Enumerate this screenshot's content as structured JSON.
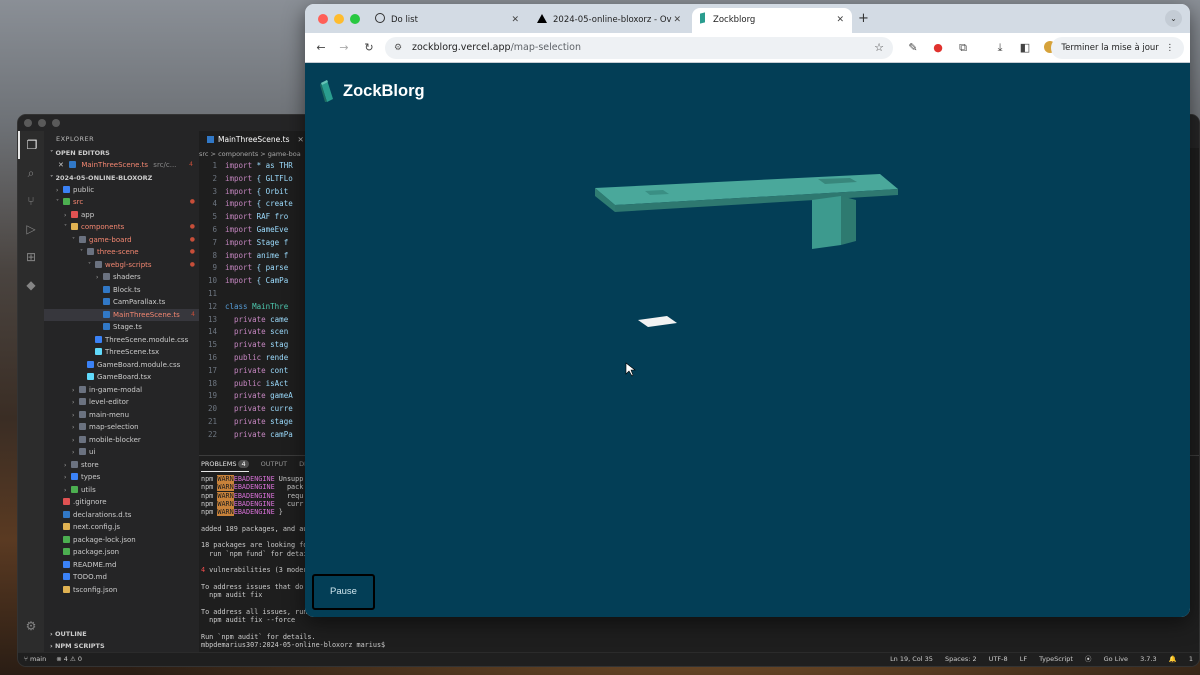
{
  "vscode": {
    "explorer_title": "EXPLORER",
    "open_editors_label": "OPEN EDITORS",
    "open_editor_file": "MainThreeScene.ts",
    "open_editor_path": "src/c...",
    "open_editor_count": "4",
    "project_label": "2024-05-ONLINE-BLOXORZ",
    "tree": [
      {
        "label": "public",
        "depth": 1,
        "folder": true,
        "open": false,
        "color": "#3b82f6"
      },
      {
        "label": "src",
        "depth": 1,
        "folder": true,
        "open": true,
        "color": "#4caf50",
        "red": true,
        "dot": true
      },
      {
        "label": "app",
        "depth": 2,
        "folder": true,
        "open": false,
        "color": "#e05252"
      },
      {
        "label": "components",
        "depth": 2,
        "folder": true,
        "open": true,
        "color": "#e0b252",
        "red": true,
        "dot": true
      },
      {
        "label": "game-board",
        "depth": 3,
        "folder": true,
        "open": true,
        "color": "#6b7280",
        "red": true,
        "dot": true
      },
      {
        "label": "three-scene",
        "depth": 4,
        "folder": true,
        "open": true,
        "color": "#6b7280",
        "red": true,
        "dot": true
      },
      {
        "label": "webgl-scripts",
        "depth": 5,
        "folder": true,
        "open": true,
        "color": "#6b7280",
        "red": true,
        "dot": true
      },
      {
        "label": "shaders",
        "depth": 6,
        "folder": true,
        "open": false,
        "color": "#6b7280"
      },
      {
        "label": "Block.ts",
        "depth": 6,
        "folder": false,
        "color": "#3178c6"
      },
      {
        "label": "CamParallax.ts",
        "depth": 6,
        "folder": false,
        "color": "#3178c6"
      },
      {
        "label": "MainThreeScene.ts",
        "depth": 6,
        "folder": false,
        "color": "#3178c6",
        "red": true,
        "selected": true,
        "count": "4"
      },
      {
        "label": "Stage.ts",
        "depth": 6,
        "folder": false,
        "color": "#3178c6"
      },
      {
        "label": "ThreeScene.module.css",
        "depth": 5,
        "folder": false,
        "color": "#3b82f6"
      },
      {
        "label": "ThreeScene.tsx",
        "depth": 5,
        "folder": false,
        "color": "#61dafb"
      },
      {
        "label": "GameBoard.module.css",
        "depth": 4,
        "folder": false,
        "color": "#3b82f6"
      },
      {
        "label": "GameBoard.tsx",
        "depth": 4,
        "folder": false,
        "color": "#61dafb"
      },
      {
        "label": "in-game-modal",
        "depth": 3,
        "folder": true,
        "open": false,
        "color": "#6b7280"
      },
      {
        "label": "level-editor",
        "depth": 3,
        "folder": true,
        "open": false,
        "color": "#6b7280"
      },
      {
        "label": "main-menu",
        "depth": 3,
        "folder": true,
        "open": false,
        "color": "#6b7280"
      },
      {
        "label": "map-selection",
        "depth": 3,
        "folder": true,
        "open": false,
        "color": "#6b7280"
      },
      {
        "label": "mobile-blocker",
        "depth": 3,
        "folder": true,
        "open": false,
        "color": "#6b7280"
      },
      {
        "label": "ui",
        "depth": 3,
        "folder": true,
        "open": false,
        "color": "#6b7280"
      },
      {
        "label": "store",
        "depth": 2,
        "folder": true,
        "open": false,
        "color": "#6b7280"
      },
      {
        "label": "types",
        "depth": 2,
        "folder": true,
        "open": false,
        "color": "#3b82f6"
      },
      {
        "label": "utils",
        "depth": 2,
        "folder": true,
        "open": false,
        "color": "#4caf50"
      },
      {
        "label": ".gitignore",
        "depth": 1,
        "folder": false,
        "color": "#e05252"
      },
      {
        "label": "declarations.d.ts",
        "depth": 1,
        "folder": false,
        "color": "#3178c6"
      },
      {
        "label": "next.config.js",
        "depth": 1,
        "folder": false,
        "color": "#e0b252"
      },
      {
        "label": "package-lock.json",
        "depth": 1,
        "folder": false,
        "color": "#4caf50"
      },
      {
        "label": "package.json",
        "depth": 1,
        "folder": false,
        "color": "#4caf50"
      },
      {
        "label": "README.md",
        "depth": 1,
        "folder": false,
        "color": "#3b82f6"
      },
      {
        "label": "TODO.md",
        "depth": 1,
        "folder": false,
        "color": "#3b82f6"
      },
      {
        "label": "tsconfig.json",
        "depth": 1,
        "folder": false,
        "color": "#e0b252",
        "braces": true
      }
    ],
    "outline_label": "OUTLINE",
    "npm_scripts_label": "NPM SCRIPTS",
    "editor_tab": "MainThreeScene.ts",
    "breadcrumb": "src > components > game-boa",
    "code_lines": [
      {
        "n": "1",
        "kw": "import",
        "rest": " * as THR"
      },
      {
        "n": "2",
        "kw": "import",
        "rest": " { GLTFLo"
      },
      {
        "n": "3",
        "kw": "import",
        "rest": " { Orbit"
      },
      {
        "n": "4",
        "kw": "import",
        "rest": " { create"
      },
      {
        "n": "5",
        "kw": "import",
        "rest": " RAF fro"
      },
      {
        "n": "6",
        "kw": "import",
        "rest": " GameEve"
      },
      {
        "n": "7",
        "kw": "import",
        "rest": " Stage f"
      },
      {
        "n": "8",
        "kw": "import",
        "rest": " anime f"
      },
      {
        "n": "9",
        "kw": "import",
        "rest": " { parse"
      },
      {
        "n": "10",
        "kw": "import",
        "rest": " { CamPa"
      },
      {
        "n": "11",
        "kw": "",
        "rest": ""
      },
      {
        "n": "12",
        "kw": "class",
        "rest": " MainThre"
      },
      {
        "n": "13",
        "kw": "  private",
        "rest": " came"
      },
      {
        "n": "14",
        "kw": "  private",
        "rest": " scen"
      },
      {
        "n": "15",
        "kw": "  private",
        "rest": " stag"
      },
      {
        "n": "16",
        "kw": "  public",
        "rest": " rende"
      },
      {
        "n": "17",
        "kw": "  private",
        "rest": " cont"
      },
      {
        "n": "18",
        "kw": "  public",
        "rest": " isAct"
      },
      {
        "n": "19",
        "kw": "  private",
        "rest": " gameA"
      },
      {
        "n": "20",
        "kw": "  private",
        "rest": " curre"
      },
      {
        "n": "21",
        "kw": "  private",
        "rest": " stage"
      },
      {
        "n": "22",
        "kw": "  private",
        "rest": " camPa"
      }
    ],
    "panel_tabs": {
      "problems": "PROBLEMS",
      "problems_count": "4",
      "output": "OUTPUT",
      "debug": "DE"
    },
    "terminal": {
      "warn_lines": [
        {
          "pre": "npm ",
          "tag": "WARN",
          "code": "EBADENGINE",
          "rest": " Unsupp"
        },
        {
          "pre": "npm ",
          "tag": "WARN",
          "code": "EBADENGINE",
          "rest": "   pack"
        },
        {
          "pre": "npm ",
          "tag": "WARN",
          "code": "EBADENGINE",
          "rest": "   requ"
        },
        {
          "pre": "npm ",
          "tag": "WARN",
          "code": "EBADENGINE",
          "rest": "   curr"
        },
        {
          "pre": "npm ",
          "tag": "WARN",
          "code": "EBADENGINE",
          "rest": " }"
        }
      ],
      "added": "added 189 packages, and au",
      "funding1": "18 packages are looking fo",
      "funding2": "  run `npm fund` for detai",
      "vuln_count": "4",
      "vuln_text": " vulnerabilities (3 moder",
      "address1": "To address issues that do",
      "address2": "  npm audit fix",
      "address_all1": "To address all issues, run",
      "address_all2": "  npm audit fix --force",
      "run_audit": "Run `npm audit` for details.",
      "prompt": "mbpdemarius307:2024-05-online-bloxorz marius$ "
    },
    "status": {
      "branch": "main",
      "problems": "⊗ 4 ⚠ 0",
      "cursor": "Ln 19, Col 35",
      "spaces": "Spaces: 2",
      "encoding": "UTF-8",
      "eol": "LF",
      "language": "TypeScript",
      "golive": "Go Live",
      "version": "3.7.3",
      "bell": "1"
    }
  },
  "chrome": {
    "tabs": [
      {
        "label": "Do list",
        "icon": "timer-icon"
      },
      {
        "label": "2024-05-online-bloxorz - Ov",
        "icon": "vercel-triangle-icon"
      },
      {
        "label": "Zockblorg",
        "icon": "zockblorg-icon"
      }
    ],
    "url_host": "zockblorg.vercel.app",
    "url_path": "/map-selection",
    "update_label": "Terminer la mise à jour"
  },
  "app": {
    "logo_text": "ZockBlorg",
    "pause_label": "Pause",
    "colors": {
      "viewport_bg": "#033e56",
      "platform": "#3f9a8e",
      "block": "#f2f2f2"
    }
  }
}
